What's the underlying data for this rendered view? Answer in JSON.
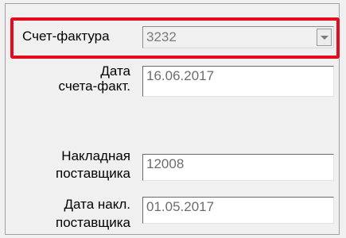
{
  "invoice": {
    "label": "Счет-фактура",
    "value": "3232"
  },
  "invoice_date": {
    "label_line1": "Дата",
    "label_line2": "счета-факт.",
    "value": "16.06.2017"
  },
  "supplier_waybill": {
    "label_line1": "Накладная",
    "label_line2": "поставщика",
    "value": "12008"
  },
  "supplier_waybill_date": {
    "label_line1": "Дата накл.",
    "label_line2": "поставщика",
    "value": "01.05.2017"
  },
  "icons": {
    "dropdown": "chevron-down-icon"
  },
  "colors": {
    "highlight": "#e30b1c",
    "window_background": "#f0f0f0",
    "field_background": "#ffffff",
    "disabled_text": "#6d6d6d"
  }
}
